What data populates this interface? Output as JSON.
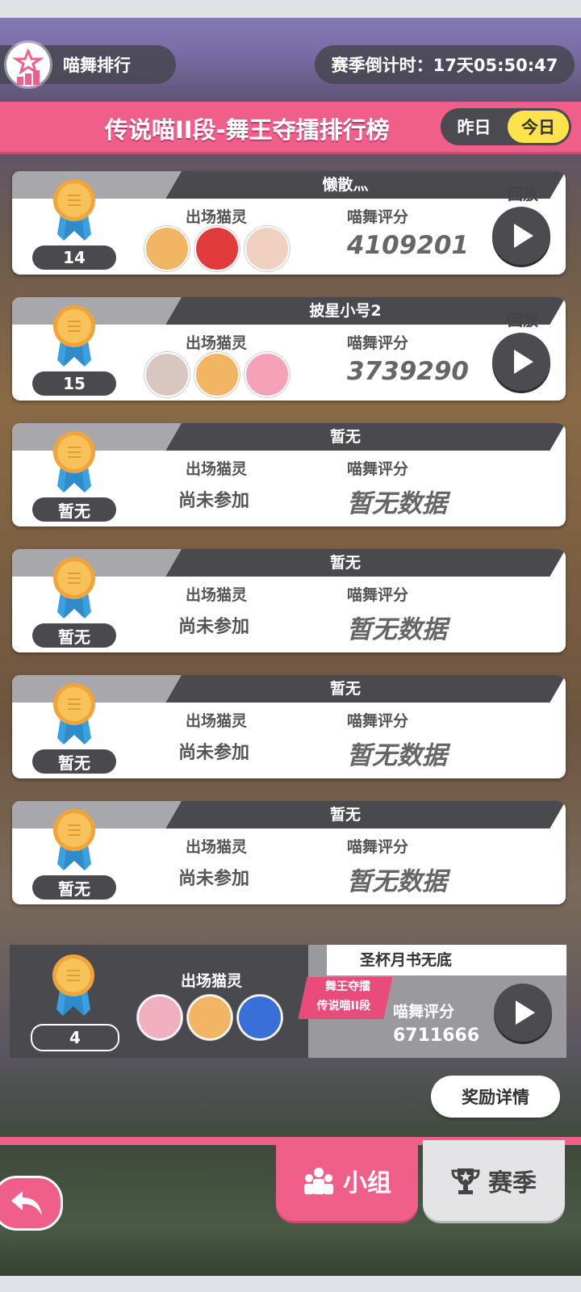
{
  "header": {
    "ranking_label": "喵舞排行",
    "season_countdown": "赛季倒计时：17天05:50:47"
  },
  "title_bar": {
    "title": "传说喵II段-舞王夺擂排行榜",
    "toggle_yesterday": "昨日",
    "toggle_today": "今日"
  },
  "labels": {
    "cats": "出场猫灵",
    "score": "喵舞评分",
    "replay": "回放",
    "not_joined": "尚未参加",
    "no_data": "暂无数据"
  },
  "entries": [
    {
      "name": "懒散灬",
      "rank": "14",
      "score": "4109201",
      "avatars": [
        "#f2b563",
        "#e23b3b",
        "#f0d0c0"
      ]
    },
    {
      "name": "披星小号2",
      "rank": "15",
      "score": "3739290",
      "avatars": [
        "#d8c7c0",
        "#f2b563",
        "#f5a2b8"
      ]
    },
    {
      "name": "暂无",
      "rank": "暂无"
    },
    {
      "name": "暂无",
      "rank": "暂无"
    },
    {
      "name": "暂无",
      "rank": "暂无"
    },
    {
      "name": "暂无",
      "rank": "暂无"
    }
  ],
  "my_entry": {
    "name": "圣杯月书无底",
    "tag_line1": "舞王夺擂",
    "tag_line2": "传说喵II段",
    "rank": "4",
    "score": "6711666",
    "avatars": [
      "#f0b0c0",
      "#f2b563",
      "#3a6fd8"
    ]
  },
  "reward_button": "奖励详情",
  "tabs": {
    "group": "小组",
    "season": "赛季"
  },
  "colors": {
    "accent_pink": "#ef5f8a",
    "toggle_active": "#ffe34d",
    "dark_header": "#4a4a4e",
    "medal_gold": "#f5b24a",
    "ribbon_blue": "#3aa0e0"
  }
}
